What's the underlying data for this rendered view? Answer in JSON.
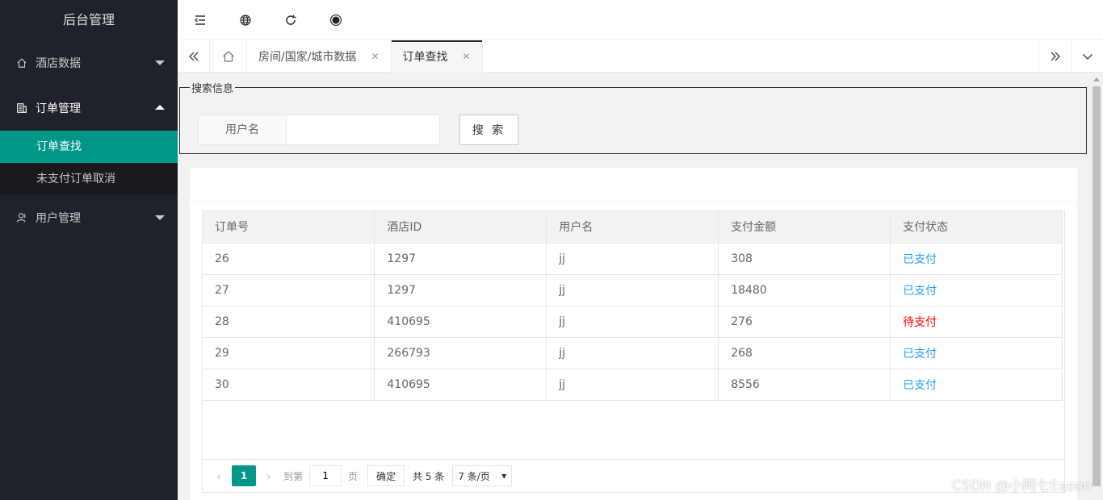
{
  "sidebar": {
    "logo": "后台管理",
    "groups": [
      {
        "label": "酒店数据",
        "icon": "home-icon",
        "expanded": false
      },
      {
        "label": "订单管理",
        "icon": "building-icon",
        "expanded": true,
        "children": [
          {
            "label": "订单查找",
            "active": true
          },
          {
            "label": "未支付订单取消",
            "active": false
          }
        ]
      },
      {
        "label": "用户管理",
        "icon": "user-icon",
        "expanded": false
      }
    ]
  },
  "header": {
    "icons": [
      "menu-fold-icon",
      "globe-icon",
      "refresh-icon",
      "theme-dot-icon"
    ]
  },
  "tabs": {
    "items": [
      {
        "label": "房间/国家/城市数据",
        "active": false
      },
      {
        "label": "订单查找",
        "active": true
      }
    ]
  },
  "search": {
    "legend": "搜索信息",
    "field_label": "用户名",
    "field_value": "",
    "button_label": "搜 索"
  },
  "table": {
    "columns": [
      "订单号",
      "酒店ID",
      "用户名",
      "支付金额",
      "支付状态"
    ],
    "rows": [
      [
        "26",
        "1297",
        "jj",
        "308",
        "已支付"
      ],
      [
        "27",
        "1297",
        "jj",
        "18480",
        "已支付"
      ],
      [
        "28",
        "410695",
        "jj",
        "276",
        "待支付"
      ],
      [
        "29",
        "266793",
        "jj",
        "268",
        "已支付"
      ],
      [
        "30",
        "410695",
        "jj",
        "8556",
        "已支付"
      ]
    ]
  },
  "pager": {
    "current": "1",
    "goto_prefix": "到第",
    "goto_value": "1",
    "goto_suffix": "页",
    "confirm": "确定",
    "total": "共 5 条",
    "page_size": "7 条/页"
  },
  "colors": {
    "sidebar_bg": "#20222a",
    "accent": "#009688",
    "paid": "#1e9fff",
    "unpaid": "#ff0000"
  },
  "watermark": "CSDN @小阿七Eason"
}
